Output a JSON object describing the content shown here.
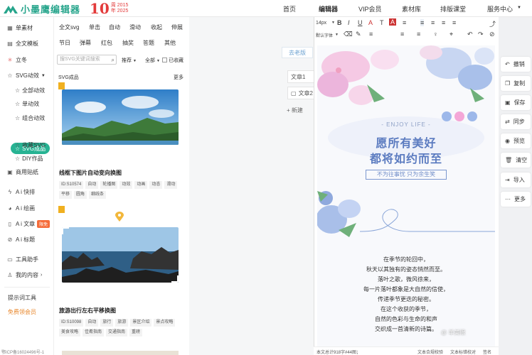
{
  "brand": {
    "name": "小墨鹰编辑器",
    "anniv_num": "10",
    "anniv_line1": "周 2015",
    "anniv_line2": "年 2025",
    "color": "#27a58c"
  },
  "nav": [
    "首页",
    "编辑器",
    "VIP会员",
    "素材库",
    "排版课堂",
    "服务中心"
  ],
  "sidebar": {
    "items": [
      {
        "label": "单素材",
        "icon": "grid-icon"
      },
      {
        "label": "全文模板",
        "icon": "template-icon"
      },
      {
        "label": "立冬",
        "icon": "snow-icon"
      },
      {
        "label": "SVG动效",
        "icon": "star-icon"
      }
    ],
    "svg_sub": [
      "全部动效",
      "单动效",
      "组合动效",
      "SVG成品",
      "收藏SVG",
      "DIY作品"
    ],
    "items2": [
      {
        "label": "商用贴纸",
        "icon": "sticker-icon"
      },
      {
        "label": "A i 快排",
        "icon": "bolt-icon"
      },
      {
        "label": "A i 绘画",
        "icon": "palette-icon"
      },
      {
        "label": "A i 文章",
        "icon": "article-icon",
        "badge": "限免"
      },
      {
        "label": "A i 标题",
        "icon": "title-icon"
      },
      {
        "label": "工具助手",
        "icon": "tool-icon"
      },
      {
        "label": "我的内容",
        "icon": "user-icon"
      }
    ],
    "bottom": [
      "提示词工具",
      "免费领会员"
    ],
    "icp": "鄂ICP备16024496号-1"
  },
  "material": {
    "tabs_row1": [
      "全文svg",
      "单击",
      "自动",
      "滑动",
      "收起",
      "伸展"
    ],
    "tabs_row2": [
      "节日",
      "弹幕",
      "红包",
      "抽奖",
      "答题",
      "其他"
    ],
    "search_placeholder": "搜SVG关键词搜索",
    "filters": [
      "推荐",
      "全部",
      "已收藏"
    ],
    "section_title": "SVG成品",
    "more": "更多",
    "cards": [
      {
        "title": "线框下图片自动变向换图",
        "tags": [
          "ID:S10574",
          "自动",
          "轮播图",
          "动效",
          "动画",
          "动态",
          "滑动",
          "平移",
          "圆角",
          "细线条"
        ]
      },
      {
        "title": "旅游出行左右平移换图",
        "tags": [
          "ID:S10098",
          "自动",
          "旅行",
          "旅游",
          "景区介绍",
          "景点攻略",
          "美食攻略",
          "佳肴指南",
          "交通指南",
          "重磅"
        ]
      }
    ]
  },
  "docs": {
    "ghost": "去老版",
    "doc1": "文章1",
    "doc2": "文章2",
    "new": "新建"
  },
  "toolbar": {
    "row1": [
      "14px",
      "B",
      "I",
      "U",
      "A",
      "T",
      "A",
      "≡",
      "≡",
      "≡",
      "≡",
      "≡",
      "⤴"
    ],
    "row2_font": "默认字体",
    "row2": [
      "⌫",
      "✎",
      "≡",
      "≡",
      "≡",
      "♀",
      "⌖",
      "↶",
      "↷",
      "⊘"
    ]
  },
  "canvas": {
    "enjoy": "- ENJOY LIFE -",
    "headline1": "愿所有美好",
    "headline2": "都将如约而至",
    "subtitle": "不为往事忧 只为余生笑",
    "poem": [
      "在季节的轮回中，",
      "秋天以其独有的姿态悄然而至。",
      "落叶之歌，微风徐来，",
      "每一片落叶都象是大自然的信使，",
      "传递季节更迭的秘密。",
      "在这个收获的季节，",
      "自然的色彩与生命的和声",
      "交织成一首清新的诗篇。"
    ],
    "status_left": "本文总计918字#44图；",
    "status_mid": "文本合规校验",
    "status_right": "文本标错校对",
    "status_end": "签名"
  },
  "rightbar": [
    {
      "label": "撤销",
      "icon": "undo-icon"
    },
    {
      "label": "复制",
      "icon": "copy-icon"
    },
    {
      "label": "保存",
      "icon": "save-icon"
    },
    {
      "label": "同步",
      "icon": "sync-icon"
    },
    {
      "label": "预览",
      "icon": "eye-icon"
    },
    {
      "label": "清空",
      "icon": "trash-icon"
    },
    {
      "label": "导入",
      "icon": "import-icon"
    },
    {
      "label": "更多",
      "icon": "more-icon"
    }
  ],
  "watermark": "@ 羊美眼"
}
